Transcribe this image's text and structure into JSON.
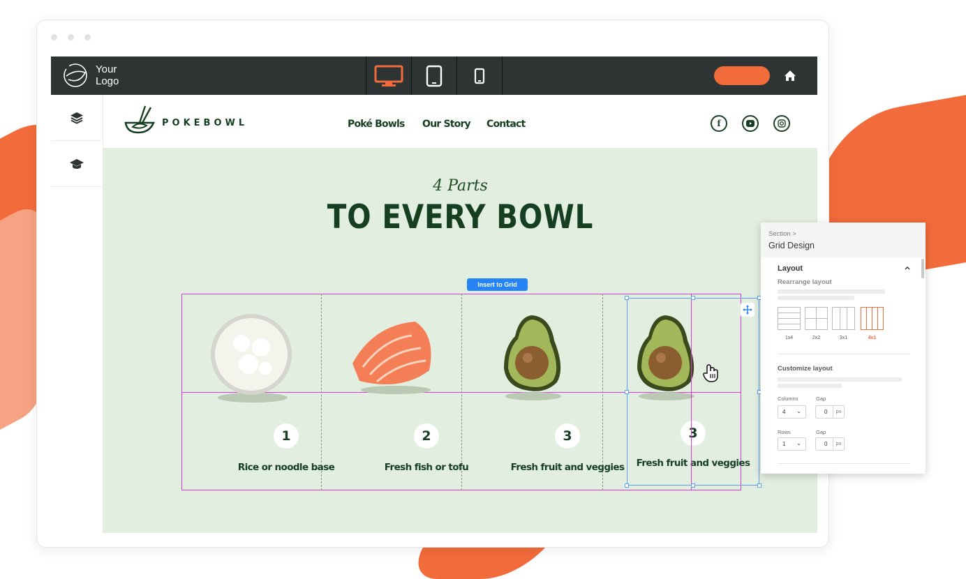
{
  "app": {
    "logo_text": "Your\nLogo",
    "devices": [
      {
        "name": "desktop",
        "active": true
      },
      {
        "name": "tablet",
        "active": false
      },
      {
        "name": "mobile",
        "active": false
      }
    ],
    "accent_color": "#f26b3a"
  },
  "site": {
    "brand": "POKEBOWL",
    "nav": [
      "Poké Bowls",
      "Our Story",
      "Contact"
    ],
    "social": [
      "facebook-icon",
      "youtube-icon",
      "instagram-icon"
    ],
    "subtitle": "4 Parts",
    "title": "TO EVERY BOWL",
    "insert_label": "Insert to Grid",
    "cells": [
      {
        "image": "rice-bowl",
        "number": "1",
        "caption": "Rice or noodle base"
      },
      {
        "image": "salmon-slices",
        "number": "2",
        "caption": "Fresh fish or tofu"
      },
      {
        "image": "avocado-half",
        "number": "3",
        "caption": "Fresh fruit and veggies"
      },
      {
        "image": "avocado-half",
        "number": "3",
        "caption": "Fresh fruit and veggies"
      }
    ],
    "background": "#e2eee0",
    "text_color": "#163f22"
  },
  "panel": {
    "breadcrumb": "Section >",
    "title": "Grid Design",
    "layout_heading": "Layout",
    "rearrange_label": "Rearrange layout",
    "layout_options": [
      {
        "label": "1x4",
        "selected": false
      },
      {
        "label": "2x2",
        "selected": false
      },
      {
        "label": "3x1",
        "selected": false
      },
      {
        "label": "4x1",
        "selected": true
      }
    ],
    "customize_label": "Customize layout",
    "columns_label": "Columns",
    "columns_value": "4",
    "rows_label": "Rows",
    "rows_value": "1",
    "gap_label": "Gap",
    "gap_value_1": "0",
    "gap_value_2": "0",
    "gap_unit": "px"
  }
}
